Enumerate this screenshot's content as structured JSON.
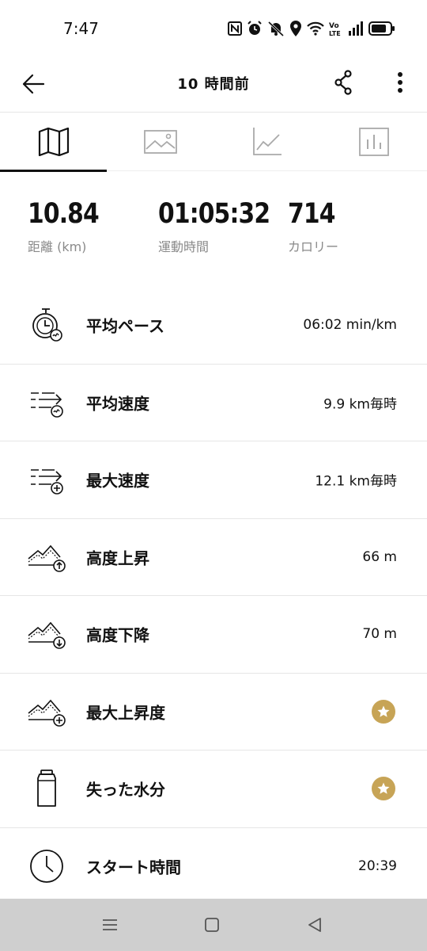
{
  "status_bar": {
    "time": "7:47",
    "icons": [
      "nfc-icon",
      "alarm-icon",
      "mute-icon",
      "location-icon",
      "wifi-icon",
      "volte-icon",
      "signal-icon",
      "battery-icon"
    ]
  },
  "header": {
    "title": "10 時間前",
    "icons": [
      "back-arrow-icon",
      "share-icon",
      "more-vert-icon"
    ]
  },
  "tabs": [
    {
      "name": "map",
      "icon": "map-icon",
      "active": true
    },
    {
      "name": "photos",
      "icon": "image-icon",
      "active": false
    },
    {
      "name": "graph",
      "icon": "line-chart-icon",
      "active": false
    },
    {
      "name": "splits",
      "icon": "bar-chart-icon",
      "active": false
    }
  ],
  "summary": [
    {
      "value": "10.84",
      "label": "距離 (km)"
    },
    {
      "value": "01:05:32",
      "label": "運動時間"
    },
    {
      "value": "714",
      "label": "カロリー"
    }
  ],
  "metrics": [
    {
      "icon": "stopwatch-pace-icon",
      "label": "平均ペース",
      "value": "06:02 min/km"
    },
    {
      "icon": "avg-speed-icon",
      "label": "平均速度",
      "value": "9.9 km毎時"
    },
    {
      "icon": "max-speed-icon",
      "label": "最大速度",
      "value": "12.1 km毎時"
    },
    {
      "icon": "ascent-icon",
      "label": "高度上昇",
      "value": "66 m"
    },
    {
      "icon": "descent-icon",
      "label": "高度下降",
      "value": "70 m"
    },
    {
      "icon": "max-altitude-icon",
      "label": "最大上昇度",
      "value": "",
      "premium": true
    },
    {
      "icon": "bottle-icon",
      "label": "失った水分",
      "value": "",
      "premium": true
    },
    {
      "icon": "clock-icon",
      "label": "スタート時間",
      "value": "20:39"
    }
  ],
  "colors": {
    "premium_badge": "#c7a456",
    "label_gray": "#8a8a8a",
    "nav_bar": "#cfcfcf"
  }
}
